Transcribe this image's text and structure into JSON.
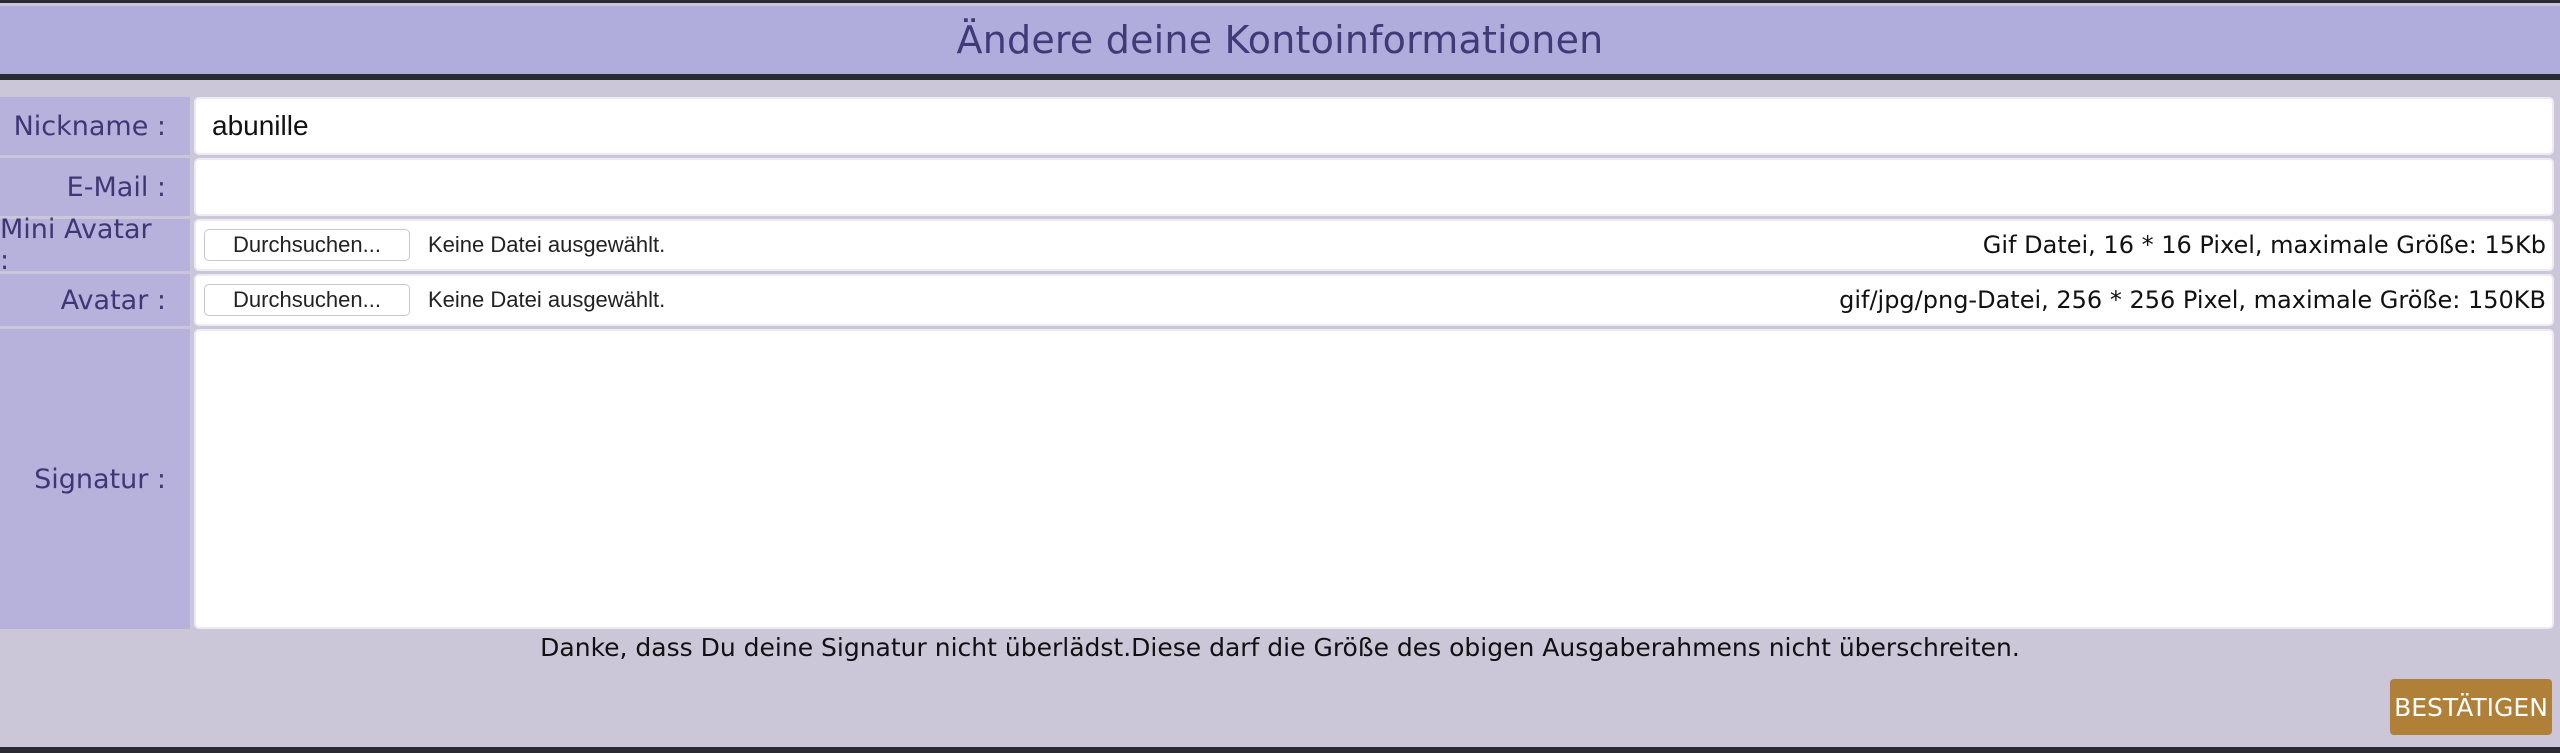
{
  "header": {
    "title": "Ändere deine Kontoinformationen"
  },
  "form": {
    "nickname": {
      "label": "Nickname :",
      "value": "abunille"
    },
    "email": {
      "label": "E-Mail :",
      "value": ""
    },
    "mini_avatar": {
      "label": "Mini Avatar :",
      "button": "Durchsuchen...",
      "status": "Keine Datei ausgewählt.",
      "hint": "Gif Datei, 16 * 16 Pixel, maximale Größe: 15Kb"
    },
    "avatar": {
      "label": "Avatar :",
      "button": "Durchsuchen...",
      "status": "Keine Datei ausgewählt.",
      "hint": "gif/jpg/png-Datei, 256 * 256 Pixel, maximale Größe: 150KB"
    },
    "signature": {
      "label": "Signatur :",
      "value": ""
    }
  },
  "note": "Danke, dass Du deine Signatur nicht überlädst.Diese darf die Größe des obigen Ausgaberahmens nicht überschreiten.",
  "actions": {
    "confirm": "BESTÄTIGEN"
  },
  "colors": {
    "header_bg": "#b0acdc",
    "label_bg": "#b7b2dc",
    "panel_bg": "#cbc6d8",
    "text_accent": "#403a78",
    "confirm_bg": "#b07f38"
  }
}
